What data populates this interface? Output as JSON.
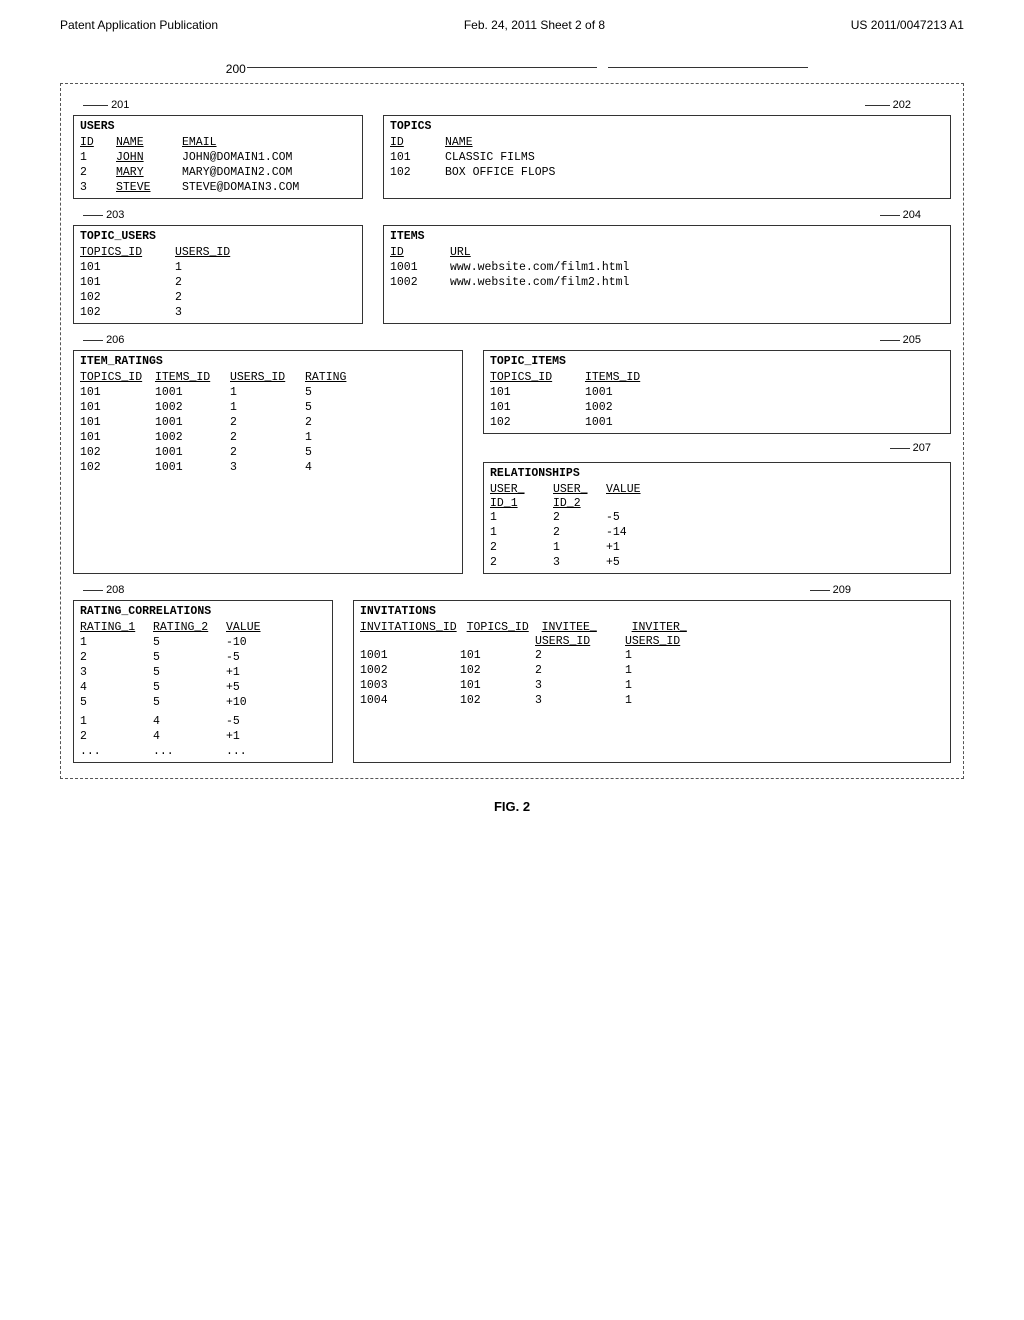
{
  "header": {
    "left": "Patent Application Publication",
    "center": "Feb. 24, 2011    Sheet 2 of 8",
    "right": "US 2011/0047213 A1"
  },
  "figure": {
    "caption": "FIG. 2",
    "label_200": "200",
    "label_201": "201",
    "label_202": "202",
    "label_203": "203",
    "label_204": "204",
    "label_205": "205",
    "label_206": "206",
    "label_207": "207",
    "label_208": "208",
    "label_209": "209"
  },
  "users_table": {
    "title": "USERS",
    "headers": [
      "ID",
      "NAME",
      "EMAIL"
    ],
    "rows": [
      {
        "id": "1",
        "name": "JOHN",
        "email": "JOHN@DOMAIN1.COM"
      },
      {
        "id": "2",
        "name": "MARY",
        "email": "MARY@DOMAIN2.COM"
      },
      {
        "id": "3",
        "name": "STEVE",
        "email": "STEVE@DOMAIN3.COM"
      }
    ]
  },
  "topics_table": {
    "title": "TOPICS",
    "headers": [
      "ID",
      "NAME"
    ],
    "rows": [
      {
        "id": "101",
        "name": "CLASSIC FILMS"
      },
      {
        "id": "102",
        "name": "BOX OFFICE FLOPS"
      }
    ]
  },
  "topic_users_table": {
    "title": "TOPIC_USERS",
    "headers": [
      "TOPICS_ID",
      "USERS_ID"
    ],
    "rows": [
      {
        "topics_id": "101",
        "users_id": "1"
      },
      {
        "topics_id": "101",
        "users_id": "2"
      },
      {
        "topics_id": "102",
        "users_id": "2"
      },
      {
        "topics_id": "102",
        "users_id": "3"
      }
    ]
  },
  "items_table": {
    "title": "ITEMS",
    "headers": [
      "ID",
      "URL"
    ],
    "rows": [
      {
        "id": "1001",
        "url": "www.website.com/film1.html"
      },
      {
        "id": "1002",
        "url": "www.website.com/film2.html"
      }
    ]
  },
  "item_ratings_table": {
    "title": "ITEM_RATINGS",
    "headers": [
      "TOPICS_ID",
      "ITEMS_ID",
      "USERS_ID",
      "RATING"
    ],
    "rows": [
      {
        "topics_id": "101",
        "items_id": "1001",
        "users_id": "1",
        "rating": "5"
      },
      {
        "topics_id": "101",
        "items_id": "1002",
        "users_id": "1",
        "rating": "5"
      },
      {
        "topics_id": "101",
        "items_id": "1001",
        "users_id": "2",
        "rating": "2"
      },
      {
        "topics_id": "101",
        "items_id": "1002",
        "users_id": "2",
        "rating": "1"
      },
      {
        "topics_id": "102",
        "items_id": "1001",
        "users_id": "2",
        "rating": "5"
      },
      {
        "topics_id": "102",
        "items_id": "1001",
        "users_id": "3",
        "rating": "4"
      }
    ]
  },
  "topic_items_table": {
    "title": "TOPIC_ITEMS",
    "headers": [
      "TOPICS_ID",
      "ITEMS_ID"
    ],
    "rows": [
      {
        "topics_id": "101",
        "items_id": "1001"
      },
      {
        "topics_id": "101",
        "items_id": "1002"
      },
      {
        "topics_id": "102",
        "items_id": "1001"
      }
    ]
  },
  "rating_correlations_table": {
    "title": "RATING_CORRELATIONS",
    "headers": [
      "RATING_1",
      "RATING_2",
      "VALUE"
    ],
    "rows": [
      {
        "r1": "1",
        "r2": "5",
        "value": "-10"
      },
      {
        "r1": "2",
        "r2": "5",
        "value": "-5"
      },
      {
        "r1": "3",
        "r2": "5",
        "value": "+1"
      },
      {
        "r1": "4",
        "r2": "5",
        "value": "+5"
      },
      {
        "r1": "5",
        "r2": "5",
        "value": "+10"
      },
      {
        "r1": "1",
        "r2": "4",
        "value": "-5"
      },
      {
        "r1": "2",
        "r2": "4",
        "value": "+1"
      },
      {
        "r1": "...",
        "r2": "...",
        "value": "..."
      }
    ]
  },
  "relationships_table": {
    "title": "RELATIONSHIPS",
    "headers": [
      "USER_ID_1",
      "USER_ID_2",
      "VALUE"
    ],
    "rows": [
      {
        "uid1": "1",
        "uid2": "2",
        "value": "-5"
      },
      {
        "uid1": "1",
        "uid2": "2",
        "value": "-14"
      },
      {
        "uid1": "2",
        "uid2": "1",
        "value": "+1"
      },
      {
        "uid1": "2",
        "uid2": "3",
        "value": "+5"
      }
    ]
  },
  "invitations_table": {
    "title": "INVITATIONS",
    "headers": [
      "INVITATIONS_ID",
      "TOPICS_ID",
      "INVITEE_USERS_ID",
      "INVITER_USERS_ID"
    ],
    "rows": [
      {
        "inv_id": "1001",
        "topics_id": "101",
        "invitee": "2",
        "inviter": "1"
      },
      {
        "inv_id": "1002",
        "topics_id": "102",
        "invitee": "2",
        "inviter": "1"
      },
      {
        "inv_id": "1003",
        "topics_id": "101",
        "invitee": "3",
        "inviter": "1"
      },
      {
        "inv_id": "1004",
        "topics_id": "102",
        "invitee": "3",
        "inviter": "1"
      }
    ]
  }
}
